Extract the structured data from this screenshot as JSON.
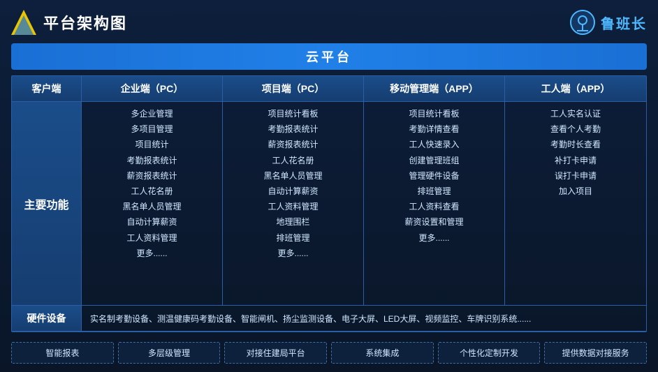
{
  "header": {
    "title": "平台架构图",
    "brand_name": "鲁班长"
  },
  "cloud_banner": "云平台",
  "col_headers": {
    "client": "客户端",
    "enterprise": "企业端（PC）",
    "project": "项目端（PC）",
    "mobile_mgmt": "移动管理端（APP）",
    "worker": "工人端（APP）"
  },
  "main_function_label": "主要功能",
  "enterprise_items": [
    "多企业管理",
    "多项目管理",
    "项目统计",
    "考勤报表统计",
    "薪资报表统计",
    "工人花名册",
    "黑名单人员管理",
    "自动计算薪资",
    "工人资料管理",
    "更多......"
  ],
  "project_items": [
    "项目统计看板",
    "考勤报表统计",
    "薪资报表统计",
    "工人花名册",
    "黑名单人员管理",
    "自动计算薪资",
    "工人资料管理",
    "地理围栏",
    "排班管理",
    "更多......"
  ],
  "mobile_items": [
    "项目统计看板",
    "考勤详情查看",
    "工人快速录入",
    "创建管理班组",
    "管理硬件设备",
    "排班管理",
    "工人资料查看",
    "薪资设置和管理",
    "更多......"
  ],
  "worker_items": [
    "工人实名认证",
    "查看个人考勤",
    "考勤时长查看",
    "补打卡申请",
    "误打卡申请",
    "加入项目"
  ],
  "hardware_label": "硬件设备",
  "hardware_content": "实名制考勤设备、测温健康码考勤设备、智能闸机、扬尘监测设备、电子大屏、LED大屏、视频监控、车牌识别系统......",
  "features": [
    "智能报表",
    "多层级管理",
    "对接住建局平台",
    "系统集成",
    "个性化定制开发",
    "提供数据对接服务"
  ]
}
